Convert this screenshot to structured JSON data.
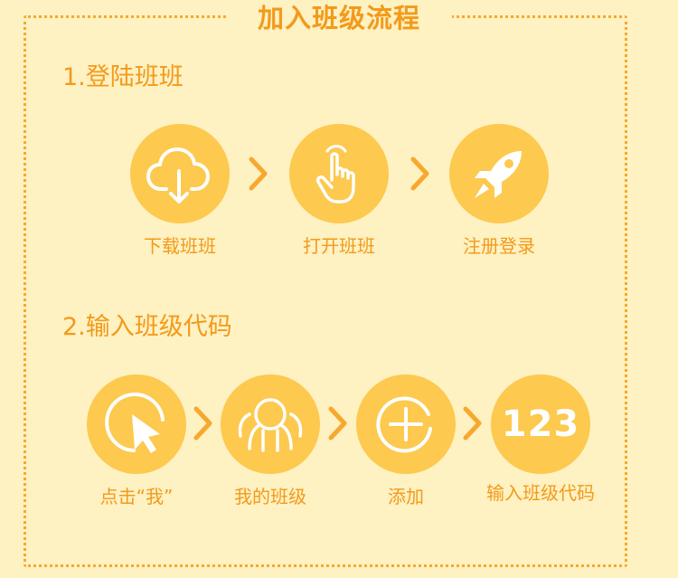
{
  "title": "加入班级流程",
  "section1": {
    "title": "1.登陆班班",
    "steps": [
      {
        "label": "下载班班",
        "icon": "cloud-download-icon"
      },
      {
        "label": "打开班班",
        "icon": "tap-hand-icon"
      },
      {
        "label": "注册登录",
        "icon": "rocket-icon"
      }
    ]
  },
  "section2": {
    "title": "2.输入班级代码",
    "steps": [
      {
        "label": "点击“我”",
        "icon": "cursor-click-icon"
      },
      {
        "label": "我的班级",
        "icon": "people-group-icon"
      },
      {
        "label": "添加",
        "icon": "add-circle-icon"
      },
      {
        "label": "输入班级代码",
        "icon": "number-123-icon",
        "icon_text": "123"
      }
    ]
  },
  "colors": {
    "background": "#FEF1C2",
    "accent": "#F39A1A",
    "circle": "#FDC94E",
    "icon": "#FFFFFF"
  }
}
